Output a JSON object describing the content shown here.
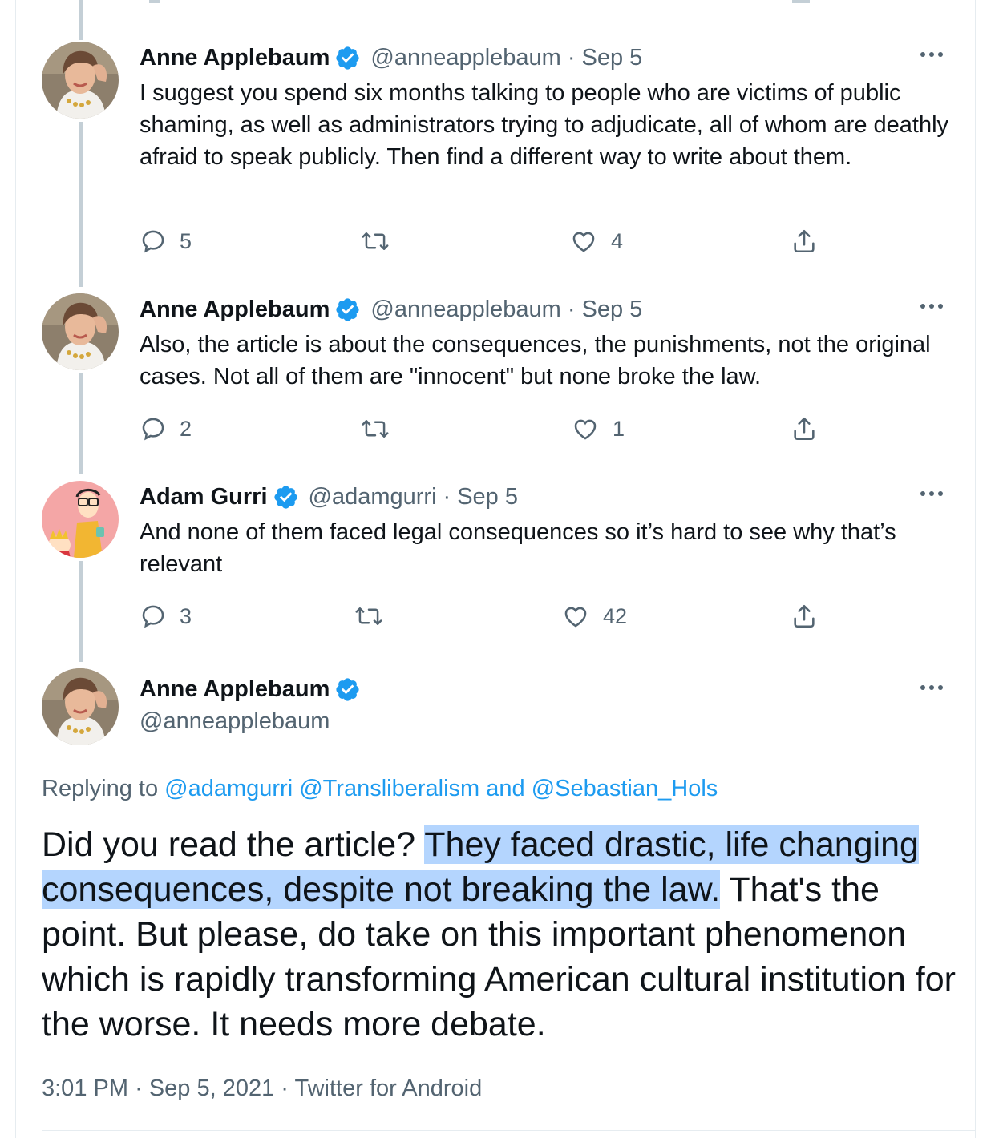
{
  "thread": [
    {
      "name": "Anne Applebaum",
      "handle": "@anneapplebaum",
      "separator": "·",
      "date": "Sep 5",
      "text": "I suggest you spend six months talking to people who are victims of public shaming, as well as administrators trying to adjudicate, all of whom are deathly afraid to speak publicly. Then find a different way to write about them.",
      "replies": "5",
      "retweets": "",
      "likes": "4"
    },
    {
      "name": "Anne Applebaum",
      "handle": "@anneapplebaum",
      "separator": "·",
      "date": "Sep 5",
      "text": "Also, the article is about the  consequences, the punishments, not the original cases. Not all of them are \"innocent\" but none broke the law.",
      "replies": "2",
      "retweets": "",
      "likes": "1"
    },
    {
      "name": "Adam Gurri",
      "handle": "@adamgurri",
      "separator": "·",
      "date": "Sep 5",
      "text": "And none of them faced legal consequences so it’s hard to see why that’s relevant",
      "replies": "3",
      "retweets": "",
      "likes": "42"
    }
  ],
  "main_tweet": {
    "name": "Anne Applebaum",
    "handle": "@anneapplebaum",
    "replying_prefix": "Replying to",
    "mentions": [
      "@adamgurri",
      "@Transliberalism",
      "@Sebastian_Hols"
    ],
    "replying_and": "and",
    "text_before": "Did you read the article? ",
    "text_highlighted_1": "They faced drastic, life changing",
    "text_highlighted_2": "consequences, despite not breaking the law.",
    "text_after": " That's the point. But please, do take on this important phenomenon which is rapidly transforming American cultural institution for the worse. It needs more debate.",
    "time": "3:01 PM",
    "date": "Sep 5, 2021",
    "source": "Twitter for Android",
    "separator": "·"
  },
  "icons": {
    "verified": "verified-badge-icon",
    "more": "more-options-icon",
    "reply": "reply-icon",
    "retweet": "retweet-icon",
    "like": "heart-icon",
    "share": "share-icon"
  },
  "colors": {
    "accent": "#1d9bf0",
    "secondary_text": "#536471",
    "highlight": "#b4d5fe",
    "thread_line": "#c4cfd6"
  }
}
